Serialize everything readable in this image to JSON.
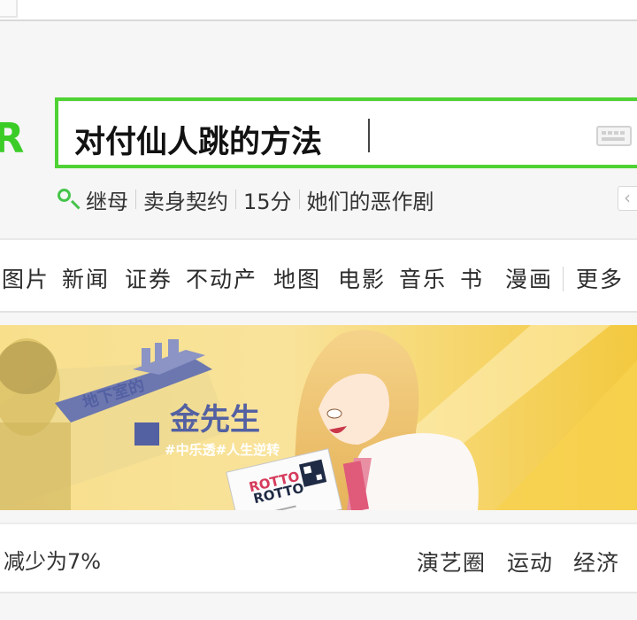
{
  "logo": {
    "text": "R",
    "color": "#3bcc28"
  },
  "search": {
    "query": "对付仙人跳的方法",
    "border_color": "#4fd234",
    "keyboard_icon": "keyboard-icon"
  },
  "hot_searches": [
    "继母",
    "卖身契约",
    "15分",
    "她们的恶作剧"
  ],
  "collapse_label": "‹",
  "nav": {
    "items": [
      "图片",
      "新闻",
      "证券",
      "不动产",
      "地图",
      "电影",
      "音乐",
      "书",
      "漫画"
    ],
    "more": "更多"
  },
  "banner": {
    "small_title": "地下室的",
    "main_title": "金先生",
    "tags": "#中乐透#人生逆转",
    "ticket_brand": "ROTTO",
    "ticket_brand2": "ROTTO"
  },
  "ticker": {
    "text": "减少为7%",
    "links": [
      "演艺圈",
      "运动",
      "经济"
    ]
  }
}
